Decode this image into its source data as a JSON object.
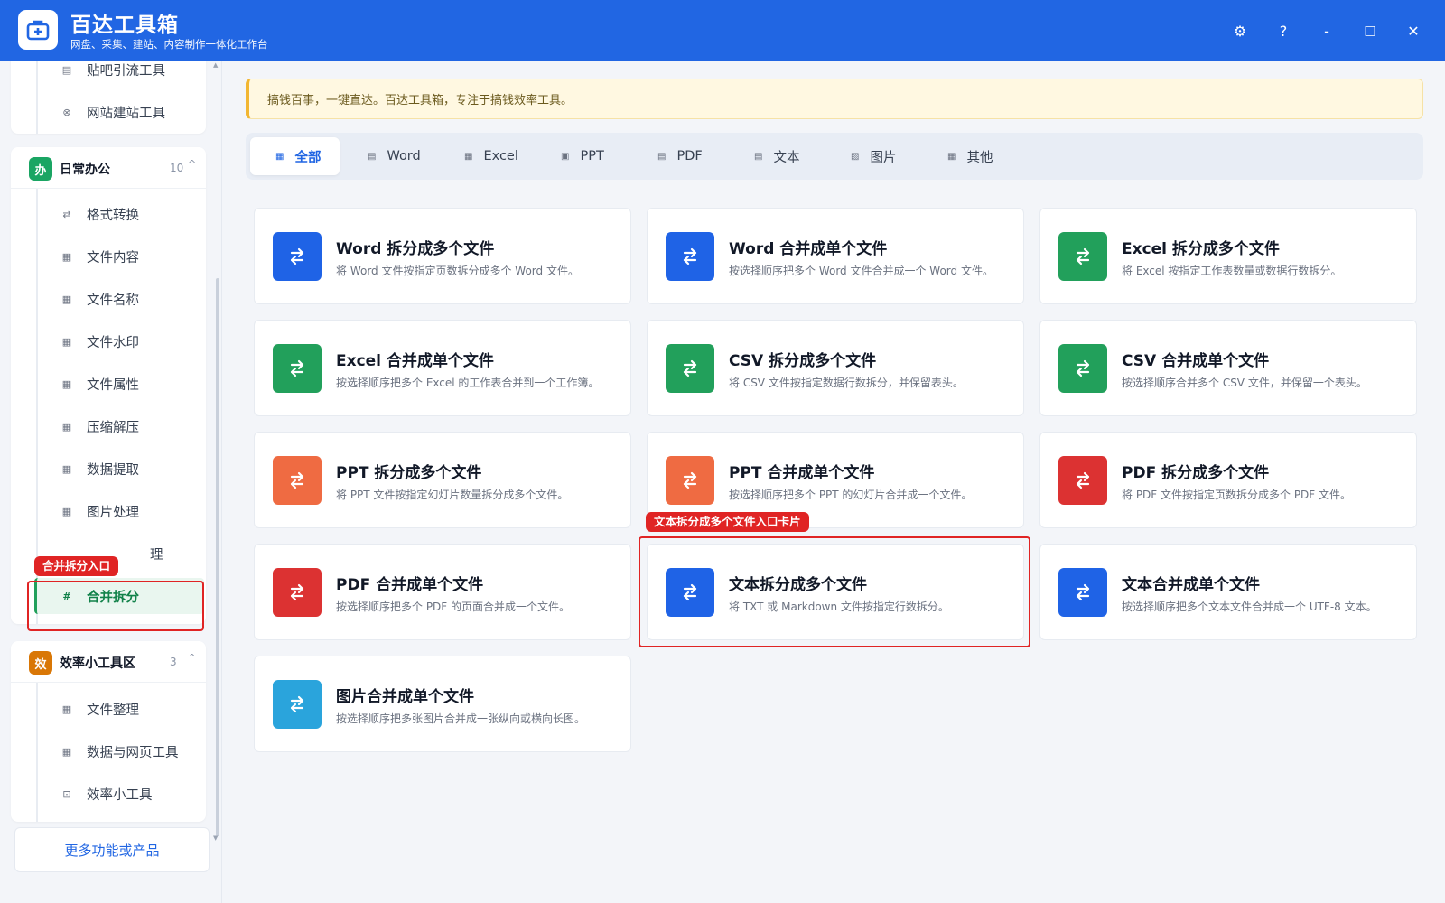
{
  "app": {
    "title": "百达工具箱",
    "subtitle": "网盘、采集、建站、内容制作一体化工作台"
  },
  "window_controls": {
    "settings": "⚙",
    "help": "?",
    "minimize": "-",
    "maximize": "□",
    "close": "✕"
  },
  "sidebar": {
    "top_group": {
      "items": [
        {
          "label": "贴吧引流工具",
          "icon": "document-icon",
          "glyph": "▤"
        },
        {
          "label": "网站建站工具",
          "icon": "globe-icon",
          "glyph": "⊗"
        }
      ]
    },
    "office_group": {
      "badge": "办",
      "badge_color": "#1aa563",
      "title": "日常办公",
      "count": "10",
      "chevron": "^",
      "items": [
        {
          "label": "格式转换",
          "icon": "swap-icon",
          "glyph": "⇄"
        },
        {
          "label": "文件内容",
          "icon": "grid-icon",
          "glyph": "▦"
        },
        {
          "label": "文件名称",
          "icon": "grid-icon",
          "glyph": "▦"
        },
        {
          "label": "文件水印",
          "icon": "grid-icon",
          "glyph": "▦"
        },
        {
          "label": "文件属性",
          "icon": "grid-icon",
          "glyph": "▦"
        },
        {
          "label": "压缩解压",
          "icon": "grid-icon",
          "glyph": "▦"
        },
        {
          "label": "数据提取",
          "icon": "grid-icon",
          "glyph": "▦"
        },
        {
          "label": "图片处理",
          "icon": "grid-icon",
          "glyph": "▦"
        },
        {
          "label": "理",
          "icon": "grid-icon",
          "glyph": ""
        },
        {
          "label": "合并拆分",
          "icon": "hash-icon",
          "glyph": "#",
          "active": true
        }
      ]
    },
    "efficiency_group": {
      "badge": "效",
      "badge_color": "#d97706",
      "title": "效率小工具区",
      "count": "3",
      "chevron": "^",
      "items": [
        {
          "label": "文件整理",
          "icon": "grid-icon",
          "glyph": "▦"
        },
        {
          "label": "数据与网页工具",
          "icon": "grid-icon",
          "glyph": "▦"
        },
        {
          "label": "效率小工具",
          "icon": "toolbox-icon",
          "glyph": "⊡"
        }
      ]
    },
    "more_link": "更多功能或产品"
  },
  "annotations": {
    "sidebar_tag": "合并拆分入口",
    "card_tag": "文本拆分成多个文件入口卡片"
  },
  "notice": "搞钱百事，一键直达。百达工具箱，专注于搞钱效率工具。",
  "tabs": [
    {
      "label": "全部",
      "icon": "grid-icon",
      "active": true
    },
    {
      "label": "Word",
      "icon": "doc-icon"
    },
    {
      "label": "Excel",
      "icon": "table-icon"
    },
    {
      "label": "PPT",
      "icon": "slides-icon"
    },
    {
      "label": "PDF",
      "icon": "pdf-icon"
    },
    {
      "label": "文本",
      "icon": "text-icon"
    },
    {
      "label": "图片",
      "icon": "image-icon"
    },
    {
      "label": "其他",
      "icon": "grid-icon"
    }
  ],
  "cards": [
    {
      "title": "Word 拆分成多个文件",
      "desc": "将 Word 文件按指定页数拆分成多个 Word 文件。",
      "color": "#1f63e6",
      "icon": "swap-icon"
    },
    {
      "title": "Word 合并成单个文件",
      "desc": "按选择顺序把多个 Word 文件合并成一个 Word 文件。",
      "color": "#1f63e6",
      "icon": "swap-icon"
    },
    {
      "title": "Excel 拆分成多个文件",
      "desc": "将 Excel 按指定工作表数量或数据行数拆分。",
      "color": "#22a05b",
      "icon": "swap-icon"
    },
    {
      "title": "Excel 合并成单个文件",
      "desc": "按选择顺序把多个 Excel 的工作表合并到一个工作簿。",
      "color": "#22a05b",
      "icon": "swap-icon"
    },
    {
      "title": "CSV 拆分成多个文件",
      "desc": "将 CSV 文件按指定数据行数拆分，并保留表头。",
      "color": "#22a05b",
      "icon": "swap-icon"
    },
    {
      "title": "CSV 合并成单个文件",
      "desc": "按选择顺序合并多个 CSV 文件，并保留一个表头。",
      "color": "#22a05b",
      "icon": "swap-icon"
    },
    {
      "title": "PPT 拆分成多个文件",
      "desc": "将 PPT 文件按指定幻灯片数量拆分成多个文件。",
      "color": "#ef6b42",
      "icon": "swap-icon"
    },
    {
      "title": "PPT 合并成单个文件",
      "desc": "按选择顺序把多个 PPT 的幻灯片合并成一个文件。",
      "color": "#ef6b42",
      "icon": "swap-icon"
    },
    {
      "title": "PDF 拆分成多个文件",
      "desc": "将 PDF 文件按指定页数拆分成多个 PDF 文件。",
      "color": "#dc3232",
      "icon": "swap-icon"
    },
    {
      "title": "PDF 合并成单个文件",
      "desc": "按选择顺序把多个 PDF 的页面合并成一个文件。",
      "color": "#dc3232",
      "icon": "swap-icon"
    },
    {
      "title": "文本拆分成多个文件",
      "desc": "将 TXT 或 Markdown 文件按指定行数拆分。",
      "color": "#1f63e6",
      "icon": "swap-icon"
    },
    {
      "title": "文本合并成单个文件",
      "desc": "按选择顺序把多个文本文件合并成一个 UTF-8 文本。",
      "color": "#1f63e6",
      "icon": "swap-icon"
    },
    {
      "title": "图片合并成单个文件",
      "desc": "按选择顺序把多张图片合并成一张纵向或横向长图。",
      "color": "#2aa4dc",
      "icon": "swap-icon"
    }
  ]
}
